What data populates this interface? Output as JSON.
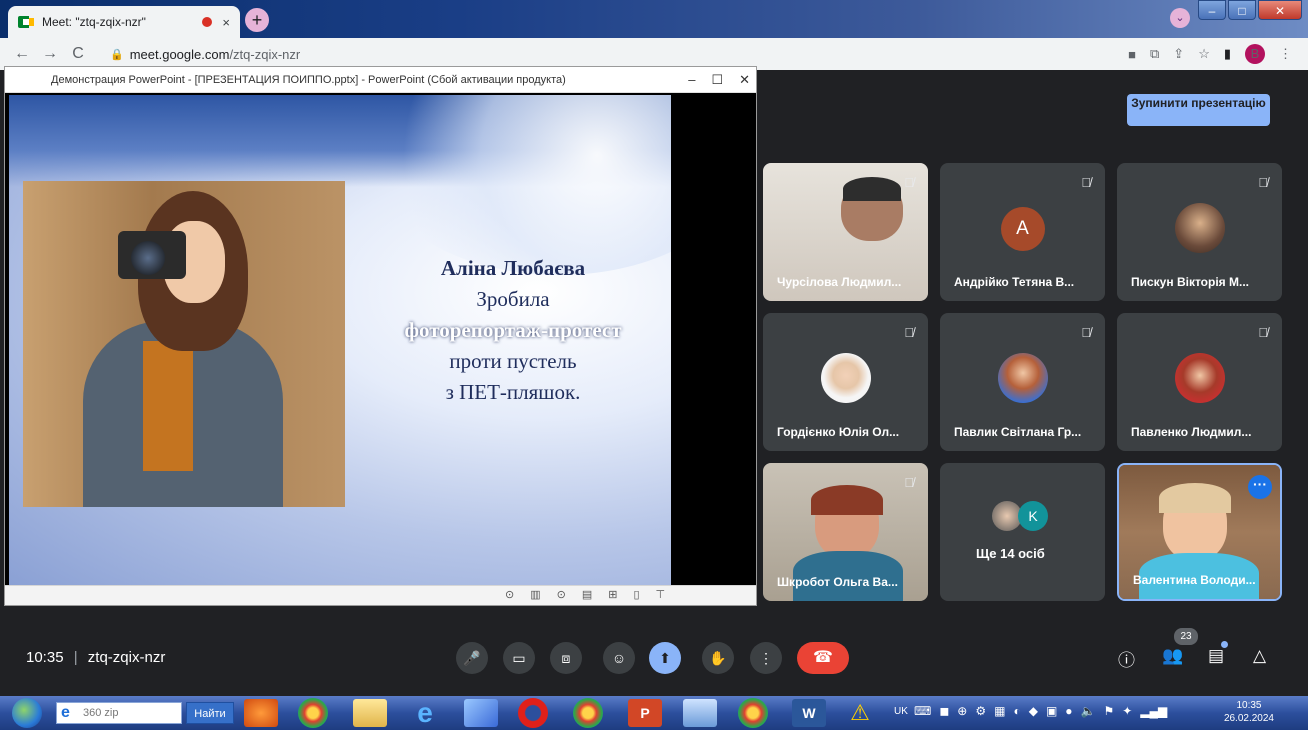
{
  "browser": {
    "tab_title": "Meet: \"ztq-zqix-nzr\"",
    "tab_close": "×",
    "new_tab": "+",
    "url_domain": "meet.google.com",
    "url_path": "/ztq-zqix-nzr",
    "profile_letter": "B"
  },
  "ppt": {
    "title": "Демонстрация PowerPoint - [ПРЕЗЕНТАЦИЯ ПОИППО.pptx] - PowerPoint (Сбой активации продукта)",
    "slide": {
      "line1": "Аліна Любаєва",
      "line2": "Зробила",
      "line3": "фоторепортаж-протест",
      "line4": "проти пустель",
      "line5": "з ПЕТ-пляшок."
    }
  },
  "meet": {
    "stop_presenting": "Зупинити презентацію",
    "participants": [
      {
        "name": "Чурсілова Людмил..."
      },
      {
        "name": "Андрійко Тетяна В...",
        "initial": "A"
      },
      {
        "name": "Пискун Вікторія М..."
      },
      {
        "name": "Гордієнко Юлія Ол..."
      },
      {
        "name": "Павлик Світлана Гр..."
      },
      {
        "name": "Павленко Людмил..."
      },
      {
        "name": "Шкробот Ольга Ва..."
      },
      {
        "name": "Ще 14 осіб",
        "initial": "K"
      },
      {
        "name": "Валентина Володи..."
      }
    ],
    "time": "10:35",
    "separator": "|",
    "meeting_code": "ztq-zqix-nzr",
    "participant_count": "23"
  },
  "taskbar": {
    "search_text": "360 zip",
    "find_button": "Найти",
    "lang": "UK",
    "time": "10:35",
    "date": "26.02.2024"
  },
  "colors": {
    "meet_bg": "#202124",
    "tile_bg": "#3c4043",
    "accent": "#8ab4f8",
    "end_call": "#ea4335"
  }
}
